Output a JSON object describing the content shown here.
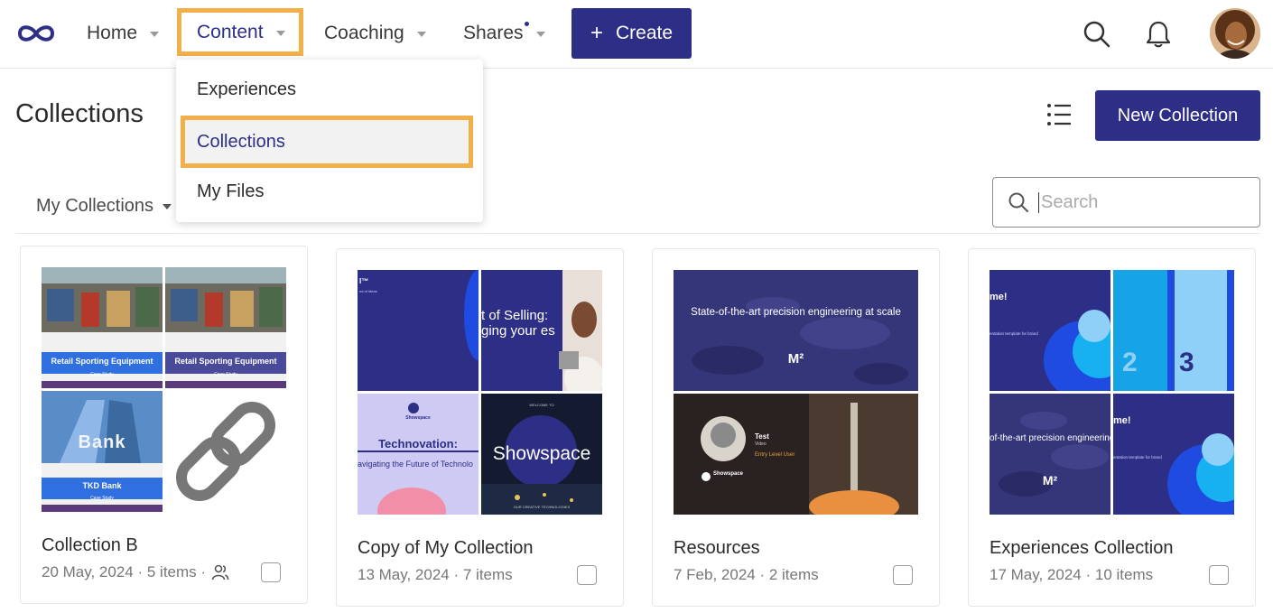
{
  "nav": {
    "home": "Home",
    "content": "Content",
    "coaching": "Coaching",
    "shares": "Shares",
    "create": "Create"
  },
  "dropdown": {
    "items": [
      "Experiences",
      "Collections",
      "My Files"
    ]
  },
  "page": {
    "title": "Collections",
    "new_collection": "New Collection",
    "filter": "My Collections",
    "search_placeholder": "Search"
  },
  "colors": {
    "accent": "#2d2f86",
    "highlight": "#f2b04a"
  },
  "cards": [
    {
      "title": "Collection B",
      "meta": "20 May, 2024 · 5 items ·",
      "shared": true,
      "thumbs": {
        "t0_title": "Retail Sporting Equipment",
        "t0_sub": "Case Study",
        "t1_title": "Retail Sporting Equipment",
        "t1_sub": "Case Study",
        "t2_title": "TKD Bank",
        "t2_sub": "Case Study",
        "t2_sign": "Bank"
      }
    },
    {
      "title": "Copy of My Collection",
      "meta": "13 May, 2024 · 7 items",
      "thumbs": {
        "t0_text": "I™",
        "t0_sub": "nd of ideas",
        "t1_text": "t of Selling: ging your es",
        "t2_brand": "Showspace",
        "t2_title": "Technovation:",
        "t2_sub": "avigating the Future of Technolo",
        "t3_top": "WELCOME TO",
        "t3_title": "Showspace",
        "t3_bottom": "OUR CREATIVE TECHNOLOGIES"
      }
    },
    {
      "title": "Resources",
      "meta": "7 Feb, 2024 · 2 items",
      "thumbs": {
        "top_text": "State-of-the-art precision engineering at scale",
        "top_logo": "M²",
        "bottom_name": "Test",
        "bottom_sub": "Video",
        "bottom_role": "Entry Level User",
        "bottom_brand": "Showspace"
      }
    },
    {
      "title": "Experiences Collection",
      "meta": "17 May, 2024 · 10 items",
      "thumbs": {
        "t0_text": "me!",
        "t0_sub": "entation template for brand",
        "t1_a": "2",
        "t1_b": "3",
        "t2_text": "of-the-art precision engineering",
        "t2_logo": "M²",
        "t3_text": "me!",
        "t3_sub": "entation template for brand"
      }
    }
  ]
}
